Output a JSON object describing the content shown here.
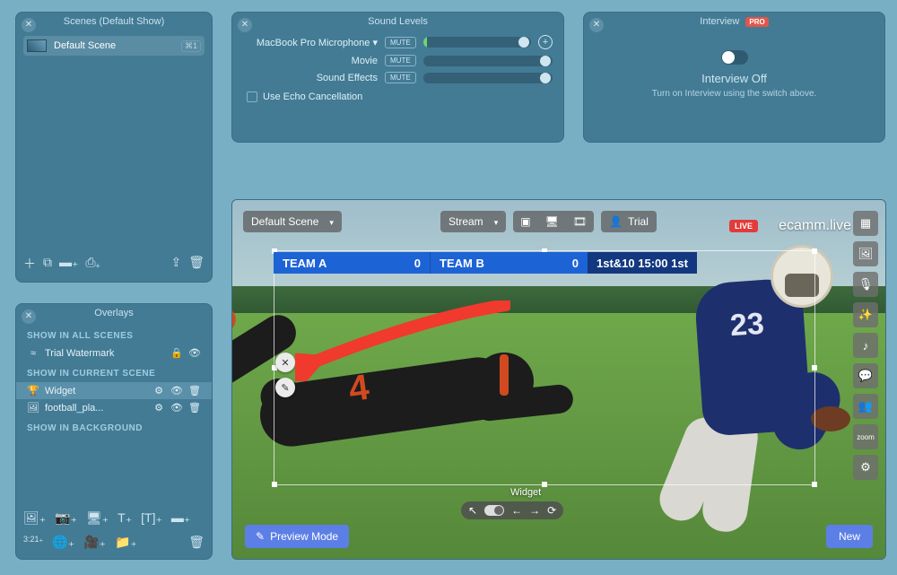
{
  "scenes_panel": {
    "title": "Scenes (Default Show)",
    "items": [
      {
        "name": "Default Scene",
        "shortcut": "⌘1"
      }
    ]
  },
  "sound_panel": {
    "title": "Sound Levels",
    "rows": [
      {
        "label": "MacBook Pro Microphone",
        "mute": "MUTE",
        "has_add": true,
        "dropdown": true
      },
      {
        "label": "Movie",
        "mute": "MUTE"
      },
      {
        "label": "Sound Effects",
        "mute": "MUTE"
      }
    ],
    "echo_label": "Use Echo Cancellation"
  },
  "interview_panel": {
    "title": "Interview",
    "badge": "PRO",
    "heading": "Interview Off",
    "sub": "Turn on Interview using the switch above."
  },
  "overlays_panel": {
    "title": "Overlays",
    "sections": {
      "all": "SHOW IN ALL SCENES",
      "current": "SHOW IN CURRENT SCENE",
      "bg": "SHOW IN BACKGROUND"
    },
    "all_items": [
      {
        "icon": "—",
        "name": "Trial Watermark",
        "locked": true
      }
    ],
    "current_items": [
      {
        "icon": "🏆",
        "name": "Widget",
        "selected": true
      },
      {
        "icon": "🖼",
        "name": "football_pla..."
      }
    ]
  },
  "preview": {
    "scene_dropdown": "Default Scene",
    "stream_dropdown": "Stream",
    "trial_label": "Trial",
    "live_label": "LIVE",
    "brand": "ecamm.live",
    "scoreboard": {
      "team_a": "TEAM A",
      "score_a": "0",
      "team_b": "TEAM B",
      "score_b": "0",
      "down": "1st&10",
      "clock": "15:00",
      "quarter": "1st"
    },
    "player1_number": "23",
    "player2_number": "4",
    "widget_label": "Widget",
    "preview_btn": "Preview Mode",
    "new_btn": "New",
    "zoom_label": "zoom"
  }
}
